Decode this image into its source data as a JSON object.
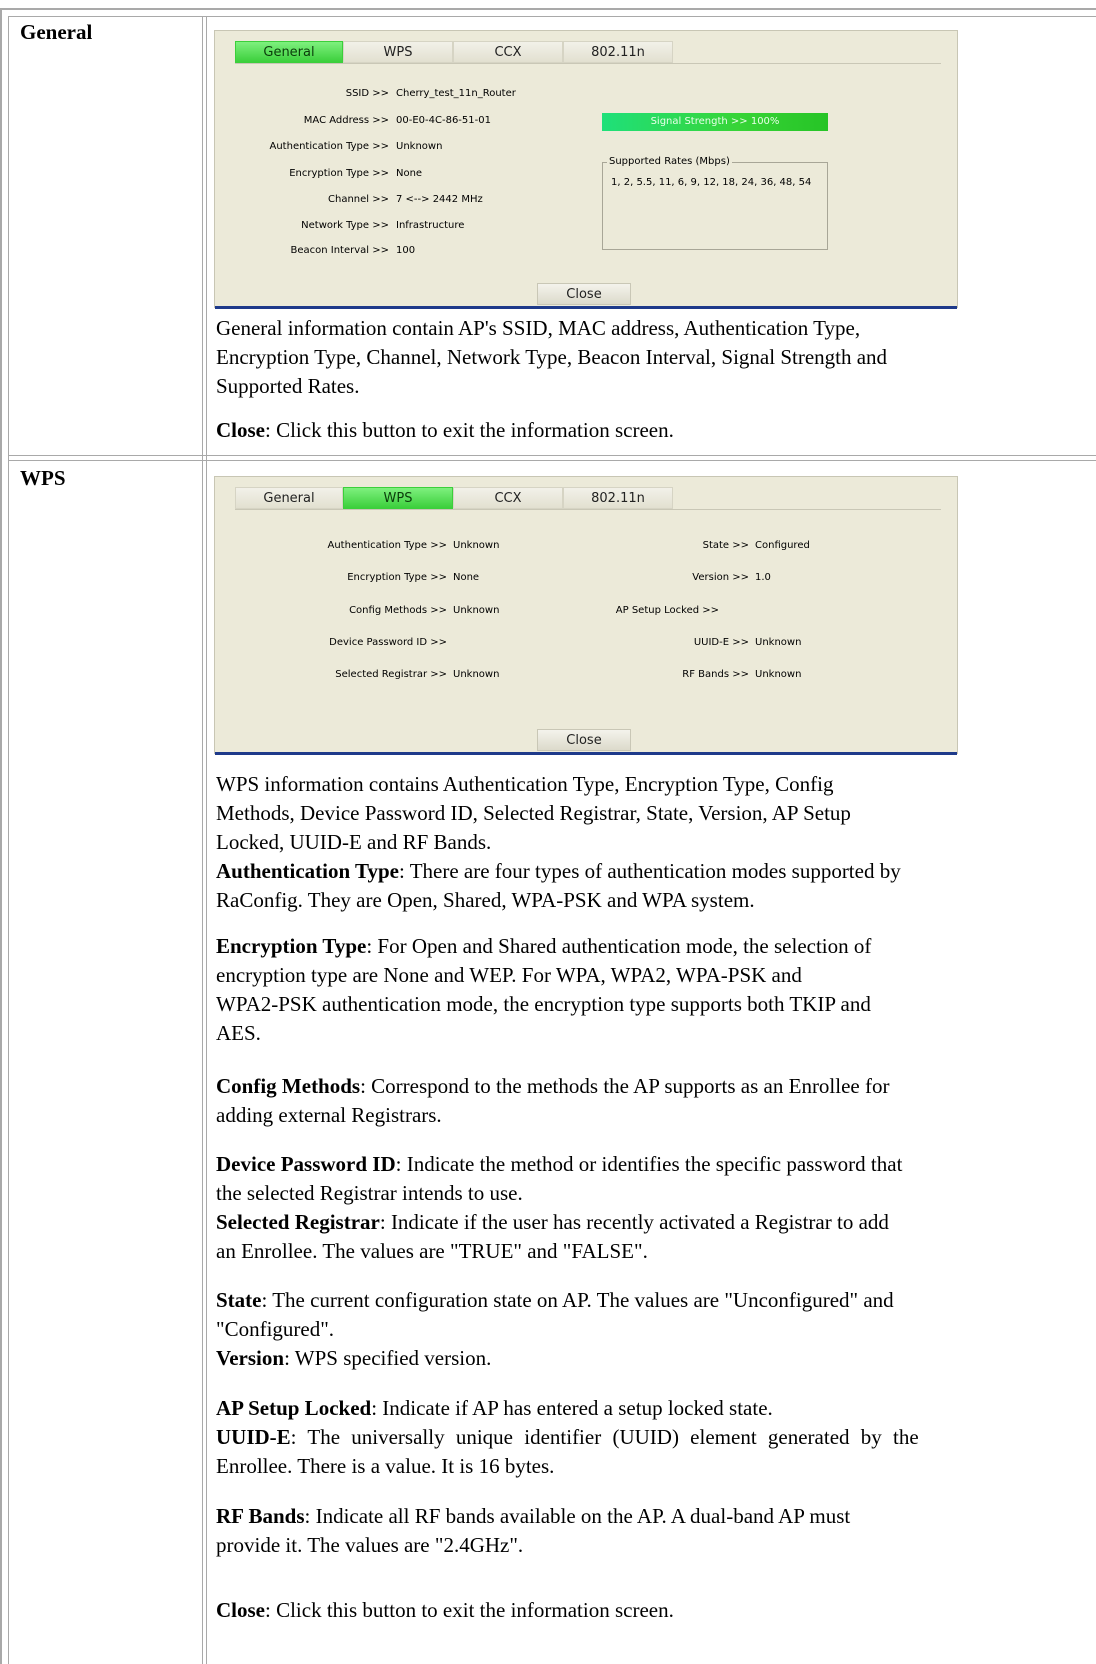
{
  "sections": {
    "general": {
      "label": "General",
      "tabs": [
        "General",
        "WPS",
        "CCX",
        "802.11n"
      ],
      "fields": [
        {
          "label": "SSID >>",
          "value": "Cherry_test_11n_Router"
        },
        {
          "label": "MAC Address >>",
          "value": "00-E0-4C-86-51-01"
        },
        {
          "label": "Authentication Type >>",
          "value": "Unknown"
        },
        {
          "label": "Encryption Type >>",
          "value": "None"
        },
        {
          "label": "Channel >>",
          "value": "7 <--> 2442 MHz"
        },
        {
          "label": "Network Type >>",
          "value": "Infrastructure"
        },
        {
          "label": "Beacon Interval >>",
          "value": "100"
        }
      ],
      "signal_strength": "Signal Strength >> 100%",
      "signal_percent": 100,
      "supported_rates_title": "Supported Rates (Mbps)",
      "supported_rates": "1, 2, 5.5, 11, 6, 9, 12, 18, 24, 36, 48, 54",
      "close_label": "Close",
      "description_lines": [
        "General information contain AP's SSID, MAC address, Authentication Type,",
        "Encryption Type, Channel, Network Type, Beacon Interval, Signal Strength and",
        "Supported Rates."
      ],
      "close_desc_term": "Close",
      "close_desc_text": ": Click this button to exit the information screen."
    },
    "wps": {
      "label": "WPS",
      "tabs": [
        "General",
        "WPS",
        "CCX",
        "802.11n"
      ],
      "left_fields": [
        {
          "label": "Authentication Type >>",
          "value": "Unknown"
        },
        {
          "label": "Encryption Type >>",
          "value": "None"
        },
        {
          "label": "Config Methods >>",
          "value": "Unknown"
        },
        {
          "label": "Device Password ID >>",
          "value": ""
        },
        {
          "label": "Selected Registrar >>",
          "value": "Unknown"
        }
      ],
      "right_fields": [
        {
          "label": "State >>",
          "value": "Configured"
        },
        {
          "label": "Version >>",
          "value": "1.0"
        },
        {
          "label": "AP Setup Locked >>",
          "value": ""
        },
        {
          "label": "UUID-E >>",
          "value": "Unknown"
        },
        {
          "label": "RF Bands >>",
          "value": "Unknown"
        }
      ],
      "close_label": "Close",
      "intro_lines": [
        "WPS information contains Authentication Type, Encryption Type, Config",
        "Methods, Device Password ID, Selected Registrar, State, Version, AP Setup",
        "Locked, UUID-E and RF Bands."
      ],
      "auth_term": "Authentication Type",
      "auth_line1": ": There are four types of authentication modes supported by",
      "auth_line2": "RaConfig. They are Open, Shared, WPA-PSK and WPA system.",
      "enc_term": "Encryption Type",
      "enc_line1": ": For Open and Shared authentication mode, the selection of",
      "enc_line2": "encryption type are None and WEP. For WPA, WPA2, WPA-PSK and",
      "enc_line3": "WPA2-PSK authentication mode, the encryption type supports both TKIP and",
      "enc_line4": "AES.",
      "config_term": "Config Methods",
      "config_line1": ": Correspond to the methods the AP supports as an Enrollee for",
      "config_line2": "adding external Registrars.",
      "dpid_term": "Device Password ID",
      "dpid_line1": ": Indicate the method or identifies the specific password that",
      "dpid_line2": "the selected Registrar intends to use.",
      "selreg_term": "Selected Registrar",
      "selreg_line1": ": Indicate if the user has recently activated a Registrar to add",
      "selreg_line2": "an Enrollee. The values are \"TRUE\" and \"FALSE\".",
      "state_term": "State",
      "state_line1": ": The current configuration state on AP. The values are \"Unconfigured\" and",
      "state_line2": "\"Configured\".",
      "version_term": "Version",
      "version_text": ": WPS specified version.",
      "aplock_term": "AP Setup Locked",
      "aplock_text": ": Indicate if AP has entered a setup locked state.",
      "uuid_term": "UUID-E",
      "uuid_line1": ": The universally unique identifier (UUID) element generated by the",
      "uuid_line2": "Enrollee. There is a value. It is 16 bytes.",
      "rf_term": "RF Bands",
      "rf_line1": ": Indicate all RF bands available on the AP. A dual-band AP must",
      "rf_line2": "provide it. The values are \"2.4GHz\".",
      "close_desc_term": "Close",
      "close_desc_text": ": Click this button to exit the information screen."
    }
  }
}
